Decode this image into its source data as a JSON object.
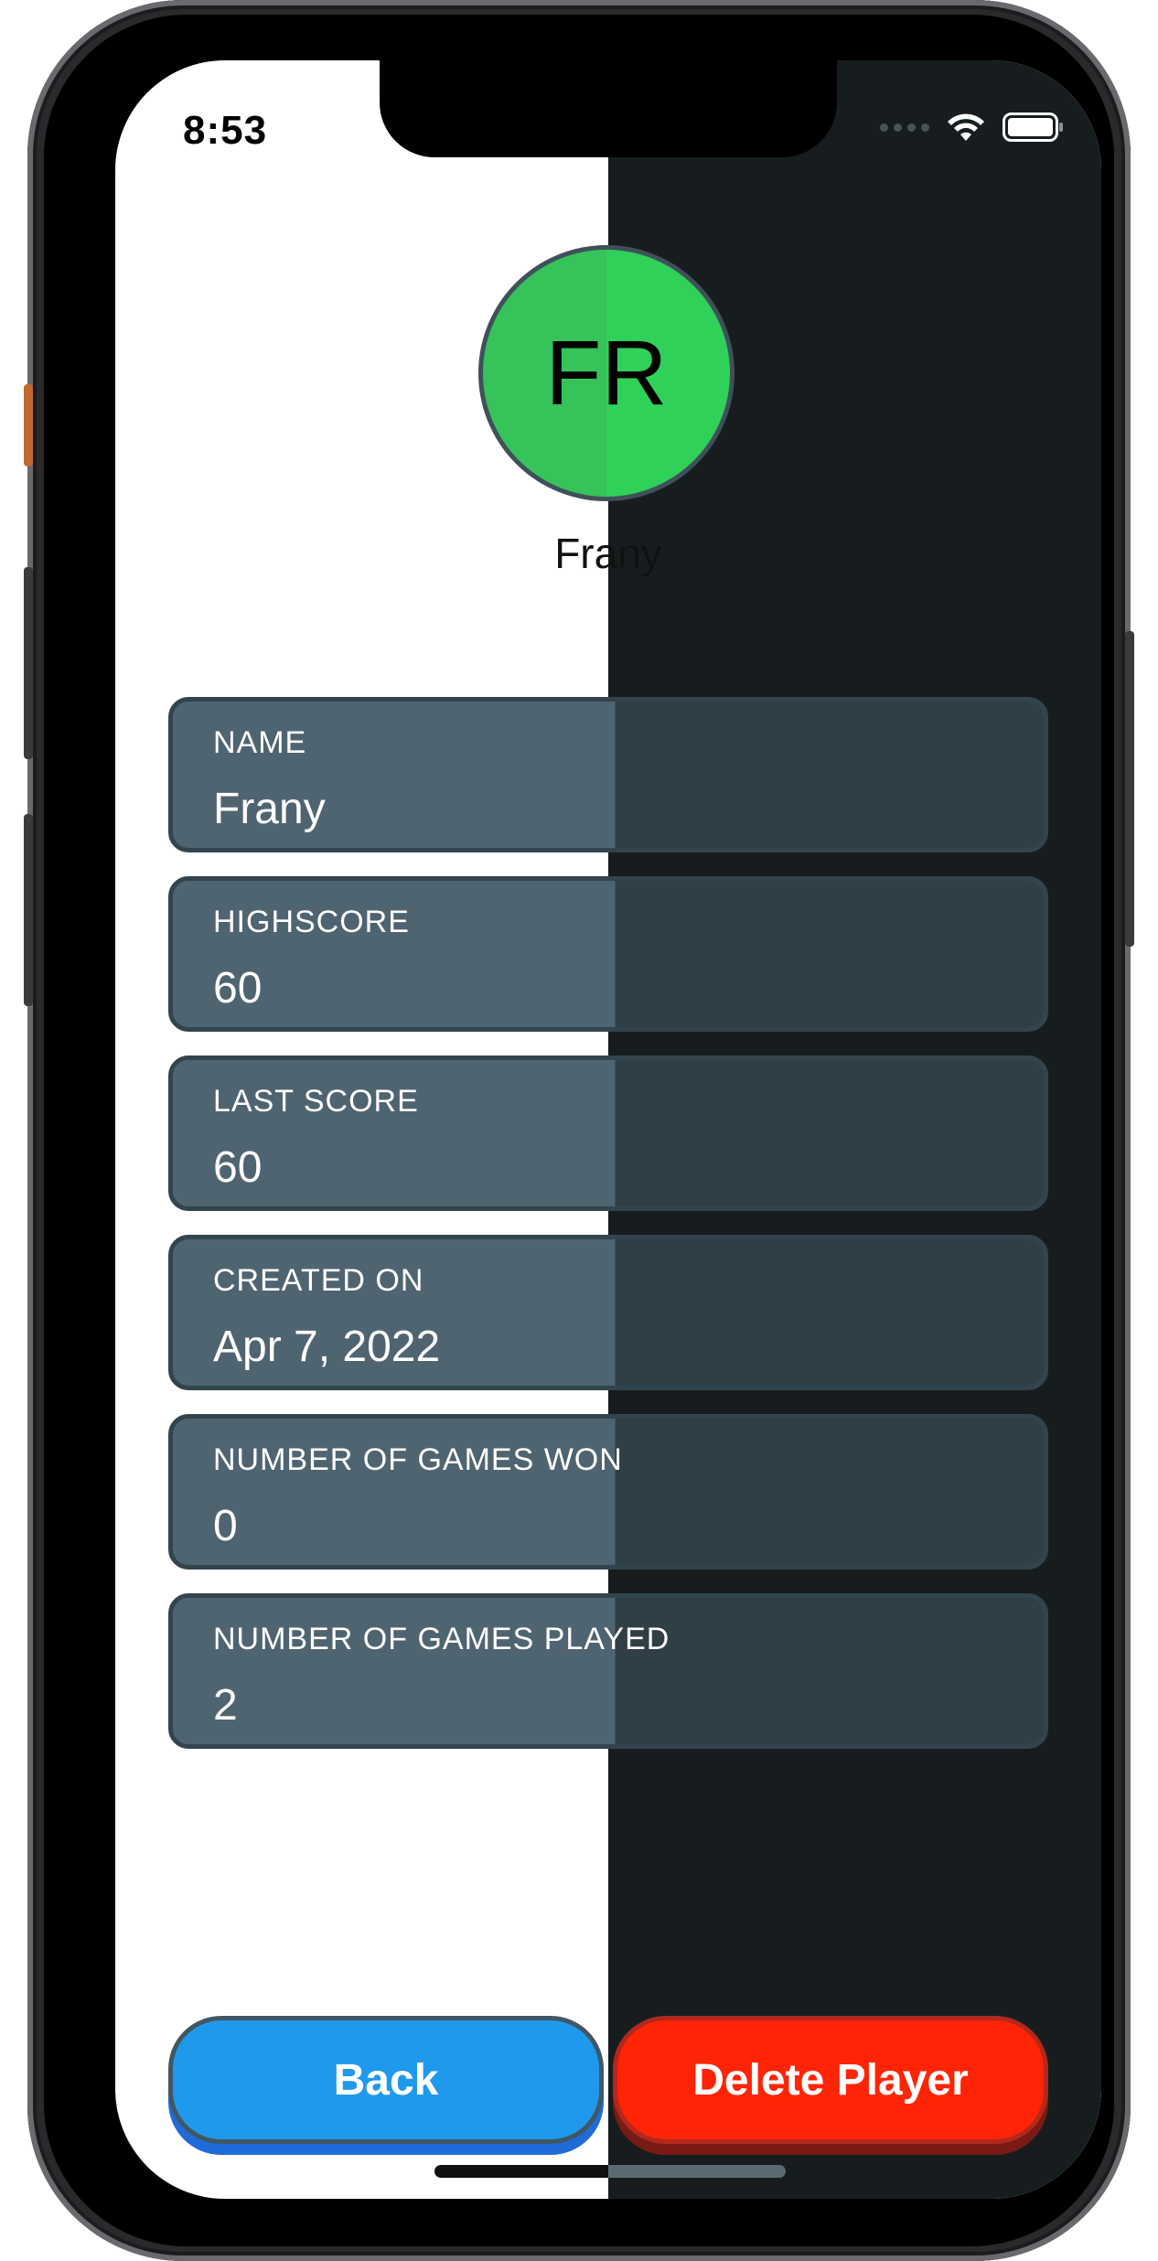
{
  "status_bar": {
    "time": "8:53"
  },
  "profile": {
    "initials": "FR",
    "name": "Frany",
    "avatar_color": "#30d158"
  },
  "fields": [
    {
      "label": "NAME",
      "value": "Frany"
    },
    {
      "label": "HIGHSCORE",
      "value": "60"
    },
    {
      "label": "LAST SCORE",
      "value": "60"
    },
    {
      "label": "CREATED ON",
      "value": "Apr 7, 2022"
    },
    {
      "label": "NUMBER OF GAMES WON",
      "value": "0"
    },
    {
      "label": "NUMBER OF GAMES PLAYED",
      "value": "2"
    }
  ],
  "actions": {
    "back_label": "Back",
    "delete_label": "Delete Player",
    "back_color": "#1f99ec",
    "delete_color": "#ff2405"
  },
  "icons": {
    "signal": "cellular-signal-icon",
    "wifi": "wifi-icon",
    "battery": "battery-icon"
  }
}
